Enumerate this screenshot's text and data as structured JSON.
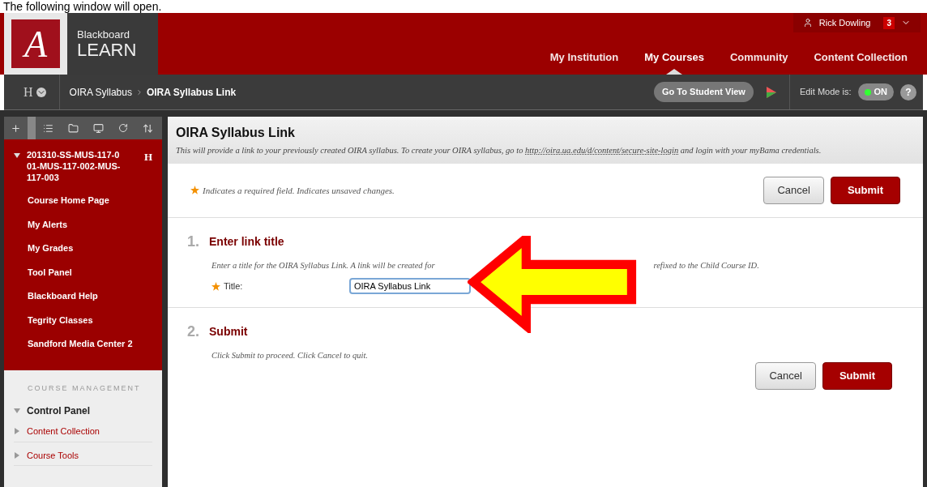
{
  "caption": "The following window will open.",
  "header": {
    "logo_letter": "A",
    "logo_words": [
      "Blackboard",
      "LEARN"
    ],
    "user": "Rick Dowling",
    "notifications": "3",
    "nav": [
      {
        "label": "My Institution",
        "selected": false
      },
      {
        "label": "My Courses",
        "selected": true
      },
      {
        "label": "Community",
        "selected": false
      },
      {
        "label": "Content Collection",
        "selected": false
      }
    ]
  },
  "breadcrumb": {
    "home": "H",
    "items": [
      "OIRA Syllabus",
      "OIRA Syllabus Link"
    ]
  },
  "student_view": "Go To Student View",
  "edit_mode": {
    "label": "Edit Mode is:",
    "on": true,
    "value": "ON",
    "help": "?"
  },
  "sidebar": {
    "course": {
      "title": "201310-SS-MUS-117-001-MUS-117-002-MUS-117-003",
      "badge": "H",
      "expanded": true
    },
    "menu": [
      "Course Home Page",
      "My Alerts",
      "My Grades",
      "Tool Panel",
      "Blackboard Help",
      "Tegrity Classes",
      "Sandford Media Center 2"
    ],
    "management": {
      "heading": "COURSE MANAGEMENT",
      "panel": {
        "label": "Control Panel",
        "expanded": true
      },
      "items": [
        {
          "label": "Content Collection",
          "expanded": false
        },
        {
          "label": "Course Tools",
          "expanded": false
        }
      ]
    }
  },
  "content": {
    "title": "OIRA Syllabus Link",
    "description": "This will provide a link to your previously created OIRA syllabus. To create your OIRA syllabus, go to ",
    "link": "http://oira.ua.edu/d/content/secure-site-login",
    "description_end": " and login with your myBama credentials.",
    "required_note": "Indicates a required field. Indicates unsaved changes.",
    "top_buttons": {
      "cancel": "Cancel",
      "submit": "Submit"
    },
    "bottom_buttons": {
      "cancel": "Cancel",
      "submit": "Submit"
    },
    "steps": [
      {
        "number": "1.",
        "title": "Enter link title",
        "instruction_parts": [
          "Enter a title for the OIRA Syllabus Link. A link will be created for",
          "refixed to the Child Course ID."
        ],
        "field": {
          "label": "Title:",
          "value": "OIRA Syllabus Link",
          "required": true
        }
      },
      {
        "number": "2.",
        "title": "Submit",
        "instruction_parts": [
          "Click Submit to proceed. Click Cancel to quit."
        ]
      }
    ]
  }
}
